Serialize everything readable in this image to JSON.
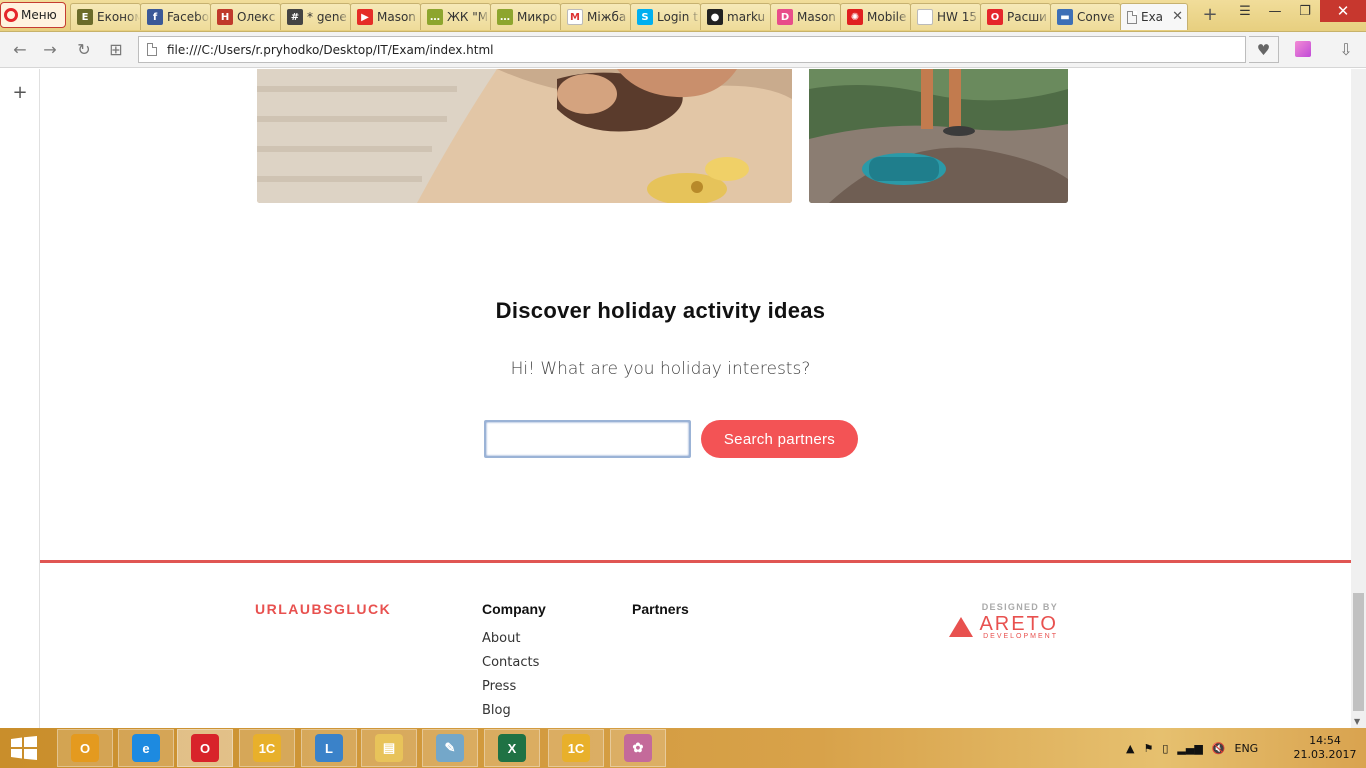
{
  "browser": {
    "menu_label": "Меню",
    "tabs": [
      {
        "label": "Економ",
        "icon": "ekonom-icon",
        "color": "#6b6b2a",
        "glyph": "E"
      },
      {
        "label": "Facebo",
        "icon": "facebook-icon",
        "color": "#3b5998",
        "glyph": "f"
      },
      {
        "label": "Олекс",
        "icon": "nz-icon",
        "color": "#c0392b",
        "glyph": "Н"
      },
      {
        "label": "* gene",
        "icon": "hash-icon",
        "color": "#444444",
        "glyph": "#"
      },
      {
        "label": "Mason",
        "icon": "youtube-icon",
        "color": "#e52d27",
        "glyph": "▶"
      },
      {
        "label": "ЖК \"М",
        "icon": "chat-icon",
        "color": "#8da52e",
        "glyph": "…"
      },
      {
        "label": "Микро",
        "icon": "chat-icon",
        "color": "#8da52e",
        "glyph": "…"
      },
      {
        "label": "Міжба",
        "icon": "gmail-icon",
        "color": "#ffffff",
        "glyph": "M"
      },
      {
        "label": "Login t",
        "icon": "skype-icon",
        "color": "#00aff0",
        "glyph": "S"
      },
      {
        "label": "marku",
        "icon": "github-icon",
        "color": "#222222",
        "glyph": "●"
      },
      {
        "label": "Mason",
        "icon": "d-icon",
        "color": "#e84d8a",
        "glyph": "D"
      },
      {
        "label": "Mobile",
        "icon": "starburst-icon",
        "color": "#e02020",
        "glyph": "✺"
      },
      {
        "label": "HW 15",
        "icon": "page-icon",
        "color": "#ffffff",
        "glyph": ""
      },
      {
        "label": "Расши",
        "icon": "opera-icon",
        "color": "#e5262b",
        "glyph": "O"
      },
      {
        "label": "Conve",
        "icon": "bubble-icon",
        "color": "#3d6fb6",
        "glyph": "▬"
      }
    ],
    "active_tab": {
      "label": "Exa",
      "icon": "page-icon"
    },
    "url": "file:///C:/Users/r.pryhodko/Desktop/IT/Exam/index.html"
  },
  "page": {
    "discover_title": "Discover holiday activity ideas",
    "discover_subtitle": "Hi! What are you holiday interests?",
    "search_value": "",
    "search_button": "Search partners",
    "footer": {
      "logo": "URLAUBSGLUCK",
      "company_heading": "Company",
      "company_links": [
        "About",
        "Contacts",
        "Press",
        "Blog"
      ],
      "partners_heading": "Partners",
      "designed_by": "DESIGNED BY",
      "areto_name": "ARETO",
      "areto_sub": "DEVELOPMENT"
    },
    "colors": {
      "accent": "#f35355",
      "footer_line": "#e05653"
    }
  },
  "taskbar": {
    "apps": [
      {
        "name": "outlook-app-button",
        "icon": "outlook-icon",
        "color": "#e49a1f",
        "glyph": "O"
      },
      {
        "name": "ie-app-button",
        "icon": "internet-explorer-icon",
        "color": "#1d8ae0",
        "glyph": "e"
      },
      {
        "name": "opera-app-button",
        "icon": "opera-icon",
        "color": "#d8232a",
        "glyph": "O"
      },
      {
        "name": "1c-app-button",
        "icon": "1c-icon",
        "color": "#e8b02b",
        "glyph": "1С"
      },
      {
        "name": "remote-desktop-app-button",
        "icon": "remote-desktop-icon",
        "color": "#3a82c9",
        "glyph": "L"
      },
      {
        "name": "explorer-app-button",
        "icon": "folder-icon",
        "color": "#e8c35a",
        "glyph": "▤"
      },
      {
        "name": "notes-app-button",
        "icon": "notepad-icon",
        "color": "#74a7c9",
        "glyph": "✎"
      },
      {
        "name": "excel-app-button",
        "icon": "excel-icon",
        "color": "#1f7244",
        "glyph": "X"
      },
      {
        "name": "1c-second-app-button",
        "icon": "1c-icon",
        "color": "#e8b02b",
        "glyph": "1С"
      },
      {
        "name": "paint-app-button",
        "icon": "paint-icon",
        "color": "#c46a9a",
        "glyph": "✿"
      }
    ],
    "language": "ENG",
    "time": "14:54",
    "date": "21.03.2017"
  }
}
